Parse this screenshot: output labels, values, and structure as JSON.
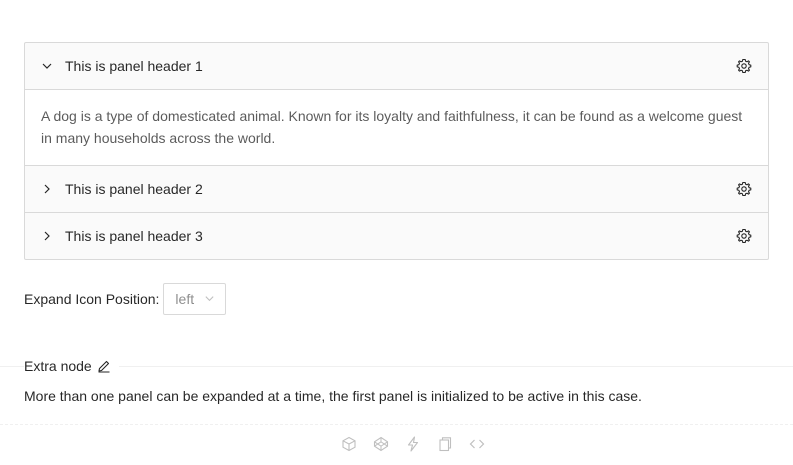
{
  "collapse": {
    "panels": [
      {
        "header": "This is panel header 1",
        "expanded": true,
        "content": "A dog is a type of domesticated animal. Known for its loyalty and faithfulness, it can be found as a welcome guest in many households across the world."
      },
      {
        "header": "This is panel header 2",
        "expanded": false
      },
      {
        "header": "This is panel header 3",
        "expanded": false
      }
    ]
  },
  "controls": {
    "expand_icon_position_label": "Expand Icon Position:",
    "expand_icon_position_value": "left"
  },
  "demo": {
    "title": "Extra node",
    "description": "More than one panel can be expanded at a time, the first panel is initialized to be active in this case."
  },
  "icons": {
    "panel_extra": "gear-icon",
    "expanded_arrow": "chevron-down-icon",
    "collapsed_arrow": "chevron-right-icon",
    "actions": [
      "codesandbox-icon",
      "codepen-icon",
      "stackblitz-icon",
      "copy-icon",
      "code-icon"
    ]
  },
  "colors": {
    "panel_header_bg": "#fafafa",
    "border": "#d9d9d9",
    "text": "#262626",
    "muted_text": "#595959",
    "icon": "#bfbfbf"
  }
}
